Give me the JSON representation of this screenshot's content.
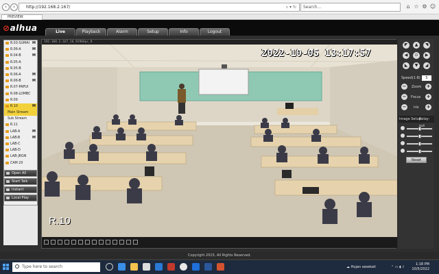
{
  "browser": {
    "url": "http://192.168.2.167/",
    "search_placeholder": "Search...",
    "tab_title": "PREVIEW"
  },
  "app": {
    "logo_text": "alhua",
    "menu": [
      {
        "label": "Live",
        "active": true
      },
      {
        "label": "Playback",
        "active": false
      },
      {
        "label": "Alarm",
        "active": false
      },
      {
        "label": "Setup",
        "active": false
      },
      {
        "label": "Info",
        "active": false
      },
      {
        "label": "Logout",
        "active": false
      }
    ]
  },
  "channels": [
    {
      "label": "R.03-SUMAI",
      "flag": "M",
      "icon": "camera-icon"
    },
    {
      "label": "R.06-A",
      "flag": "M",
      "icon": "camera-icon"
    },
    {
      "label": "R.04-B",
      "flag": "M",
      "icon": "camera-icon"
    },
    {
      "label": "R.05-A",
      "flag": "",
      "icon": "camera-icon"
    },
    {
      "label": "R.05-B",
      "flag": "",
      "icon": "camera-icon"
    },
    {
      "label": "R.06-A",
      "flag": "M",
      "icon": "camera-icon"
    },
    {
      "label": "R.06-B",
      "flag": "M",
      "icon": "camera-icon"
    },
    {
      "label": "R.07-PAPUI",
      "flag": "",
      "icon": "camera-icon"
    },
    {
      "label": "R.08-LOMBC",
      "flag": "",
      "icon": "camera-icon"
    },
    {
      "label": "R.09",
      "flag": "",
      "icon": "camera-icon"
    },
    {
      "label": "R.10",
      "flag": "M",
      "icon": "camera-icon",
      "selected": true
    },
    {
      "label": "Main Stream",
      "flag": "",
      "sub": true,
      "selected": true
    },
    {
      "label": "Sub Stream",
      "flag": "",
      "sub": true
    },
    {
      "label": "R.11",
      "flag": "",
      "icon": "camera-icon"
    },
    {
      "label": "LAB-A",
      "flag": "M",
      "icon": "camera-icon"
    },
    {
      "label": "LAB-B",
      "flag": "M",
      "icon": "camera-icon"
    },
    {
      "label": "LAB-C",
      "flag": "",
      "icon": "camera-icon"
    },
    {
      "label": "LAB-D",
      "flag": "",
      "icon": "camera-icon"
    },
    {
      "label": "LAB-JRGN",
      "flag": "",
      "icon": "camera-icon"
    },
    {
      "label": "CAM 20",
      "flag": "",
      "icon": "camera-icon"
    }
  ],
  "side_buttons": [
    {
      "label": "Open All"
    },
    {
      "label": "Start Talk"
    },
    {
      "label": "Instant Record"
    },
    {
      "label": "Local Play"
    }
  ],
  "video": {
    "header_text": "192.168.2.167_10_92966ps_R",
    "osd_time": "2022-10-05 13:17:57",
    "osd_name": "R.10"
  },
  "ptz": {
    "speed_label": "Speed(1-8)",
    "speed_value": "5",
    "zoom_label": "Zoom",
    "focus_label": "Focus",
    "iris_label": "Iris"
  },
  "image_setup": {
    "tab_image": "Image Setup",
    "tab_relay": "Relay-out",
    "sliders": [
      {
        "name": "brightness",
        "value": 0.5
      },
      {
        "name": "contrast",
        "value": 0.5
      },
      {
        "name": "saturation",
        "value": 0.5
      },
      {
        "name": "hue",
        "value": 0.5
      }
    ],
    "reset_label": "Reset"
  },
  "footer": {
    "copyright": "Copyright 2015, All Rights Reserved."
  },
  "taskbar": {
    "search_placeholder": "Type here to search",
    "weather": "Hujan sesekali",
    "time": "1:18 PM",
    "date": "10/5/2022"
  }
}
